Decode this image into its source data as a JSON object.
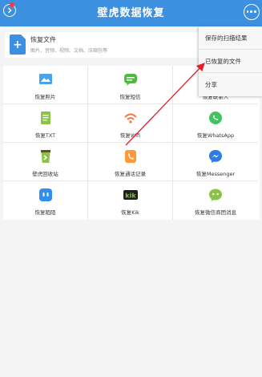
{
  "app_title": "壁虎数据恢复",
  "file_card": {
    "title": "恢复文件",
    "subtitle": "图片、音频、视频、文档、压缩包等"
  },
  "grid": [
    {
      "label": "恢复照片",
      "icon": "photo-icon",
      "color": "#4aa3e8"
    },
    {
      "label": "恢复短信",
      "icon": "sms-icon",
      "color": "#4cba3c"
    },
    {
      "label": "恢复联系人",
      "icon": "contacts-icon",
      "color": "#3d8fe0"
    },
    {
      "label": "恢复TXT",
      "icon": "txt-icon",
      "color": "#8bc34a"
    },
    {
      "label": "恢复Wifi",
      "icon": "wifi-icon",
      "color": "#ff7043"
    },
    {
      "label": "恢复WhatsApp",
      "icon": "whatsapp-icon",
      "color": "#43c35e"
    },
    {
      "label": "壁虎回收站",
      "icon": "recycle-bin-icon",
      "color": "#8bc34a"
    },
    {
      "label": "恢复通话记录",
      "icon": "call-log-icon",
      "color": "#ff9a3c"
    },
    {
      "label": "恢复Messenger",
      "icon": "messenger-icon",
      "color": "#2e7be6"
    },
    {
      "label": "恢复陌陌",
      "icon": "momo-icon",
      "color": "#2f8ef0"
    },
    {
      "label": "恢复Kik",
      "icon": "kik-icon",
      "color": "#7bc242"
    },
    {
      "label": "恢复微信商团消息",
      "icon": "wechat-icon",
      "color": "#8bc34a"
    }
  ],
  "menu": [
    {
      "label": "保存的扫描结果"
    },
    {
      "label": "已恢复的文件"
    },
    {
      "label": "分享"
    }
  ],
  "colors": {
    "header": "#3d8fe0",
    "arrow": "#e0202a"
  }
}
